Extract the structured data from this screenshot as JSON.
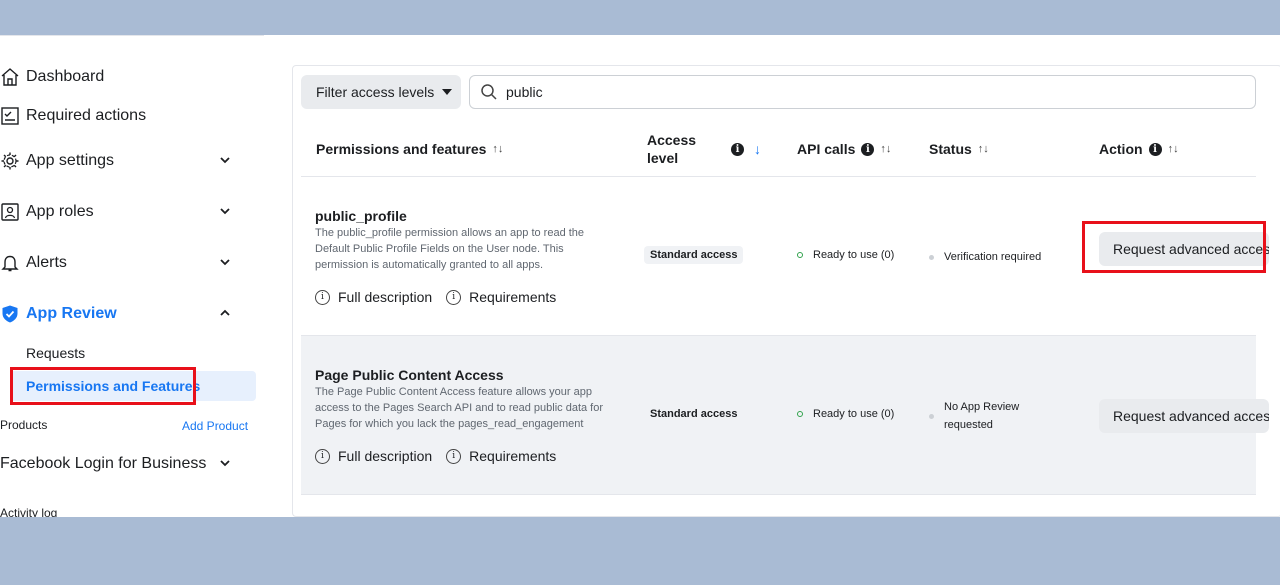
{
  "sidebar": {
    "items": [
      {
        "label": "Dashboard",
        "icon": "home-icon"
      },
      {
        "label": "Required actions",
        "icon": "checklist-icon"
      },
      {
        "label": "App settings",
        "icon": "gear-icon"
      },
      {
        "label": "App roles",
        "icon": "id-card-icon"
      },
      {
        "label": "Alerts",
        "icon": "bell-icon"
      },
      {
        "label": "App Review",
        "icon": "shield-check-icon"
      }
    ],
    "sub_items": [
      {
        "label": "Requests"
      },
      {
        "label": "Permissions and Features"
      }
    ],
    "products_label": "Products",
    "add_product_label": "Add Product",
    "facebook_login_label": "Facebook Login for Business",
    "activity_log_label": "Activity log"
  },
  "toolbar": {
    "filter_label": "Filter access levels",
    "search_value": "public"
  },
  "table": {
    "headers": {
      "permissions": "Permissions and features",
      "access_level": "Access level",
      "api_calls": "API calls",
      "status": "Status",
      "action": "Action"
    },
    "rows": [
      {
        "name": "public_profile",
        "description": "The public_profile permission allows an app to read the Default Public Profile Fields on the User node. This permission is automatically granted to all apps.",
        "full_description": "Full description",
        "requirements": "Requirements",
        "access_level": "Standard access",
        "api_calls": "Ready to use (0)",
        "status": "Verification required",
        "action": "Request advanced access"
      },
      {
        "name": "Page Public Content Access",
        "description": "The Page Public Content Access feature allows your app access to the Pages Search API and to read public data for Pages for which you lack the pages_read_engagement",
        "full_description": "Full description",
        "requirements": "Requirements",
        "access_level": "Standard access",
        "api_calls": "Ready to use (0)",
        "status": "No App Review requested",
        "action": "Request advanced access"
      }
    ]
  },
  "colors": {
    "accent": "#1877f2",
    "highlight": "#e8101a",
    "background_frame": "#a9bbd4",
    "ready_green": "#31a24c"
  }
}
